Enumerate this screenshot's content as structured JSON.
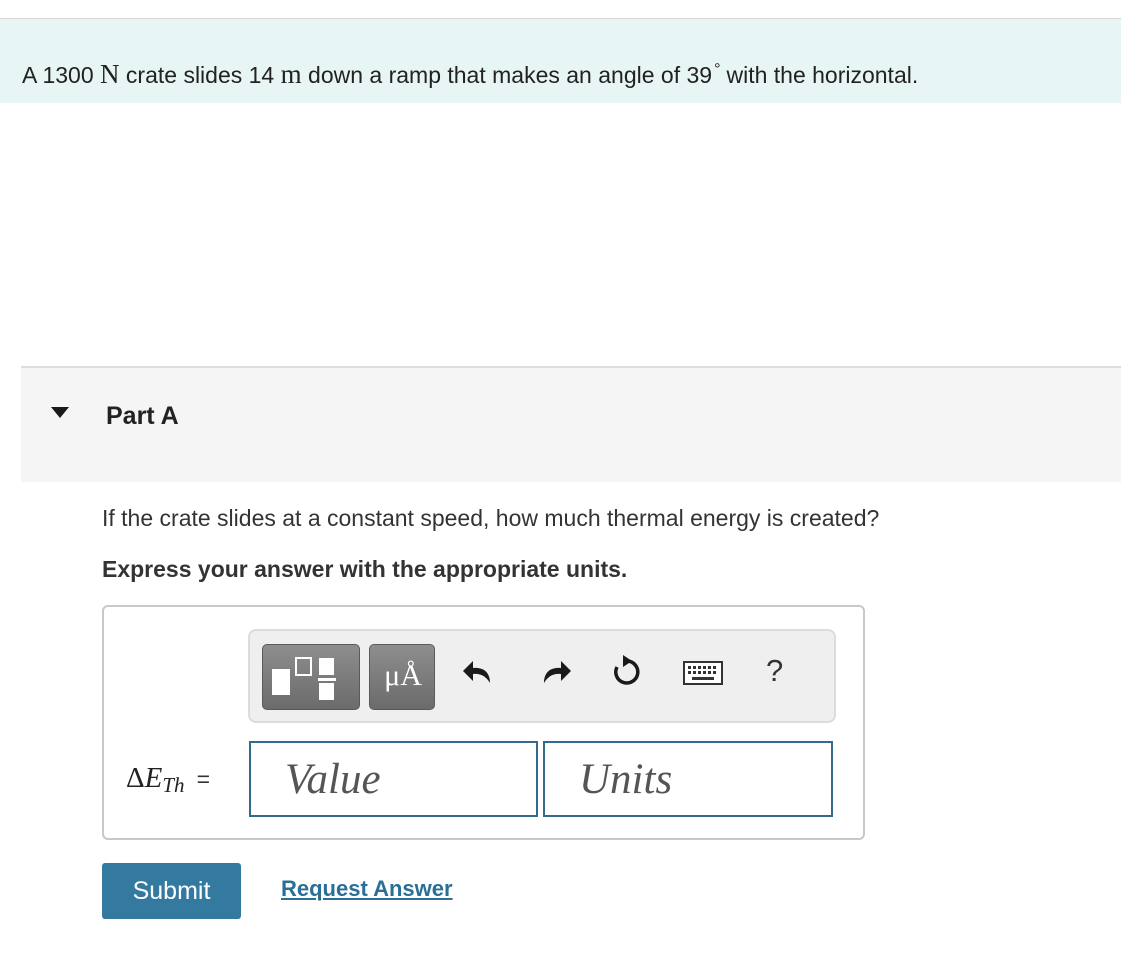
{
  "problem": {
    "text_before_force": "A 1300",
    "force_unit": "N",
    "text_before_distance": "crate slides 14",
    "distance_unit": "m",
    "text_before_angle": "down a ramp that makes an angle of 39",
    "degree_symbol": "°",
    "text_after_angle": "with the horizontal."
  },
  "part": {
    "title": "Part A",
    "question": "If the crate slides at a constant speed, how much thermal energy is created?",
    "instruction": "Express your answer with the appropriate units."
  },
  "toolbar": {
    "units_button_label": "μÅ",
    "help_label": "?",
    "icons": [
      "templates-icon",
      "units-icon",
      "undo-icon",
      "redo-icon",
      "reset-icon",
      "keyboard-icon",
      "help-icon"
    ]
  },
  "answer": {
    "symbol_delta": "Δ",
    "symbol_var": "E",
    "symbol_sub": "Th",
    "equals": "=",
    "value_placeholder": "Value",
    "units_placeholder": "Units"
  },
  "actions": {
    "submit_label": "Submit",
    "request_label": "Request Answer"
  },
  "colors": {
    "problem_bg": "#e8f5f5",
    "submit_bg": "#347aa0",
    "link": "#2a6f97",
    "field_border": "#336b8c"
  }
}
